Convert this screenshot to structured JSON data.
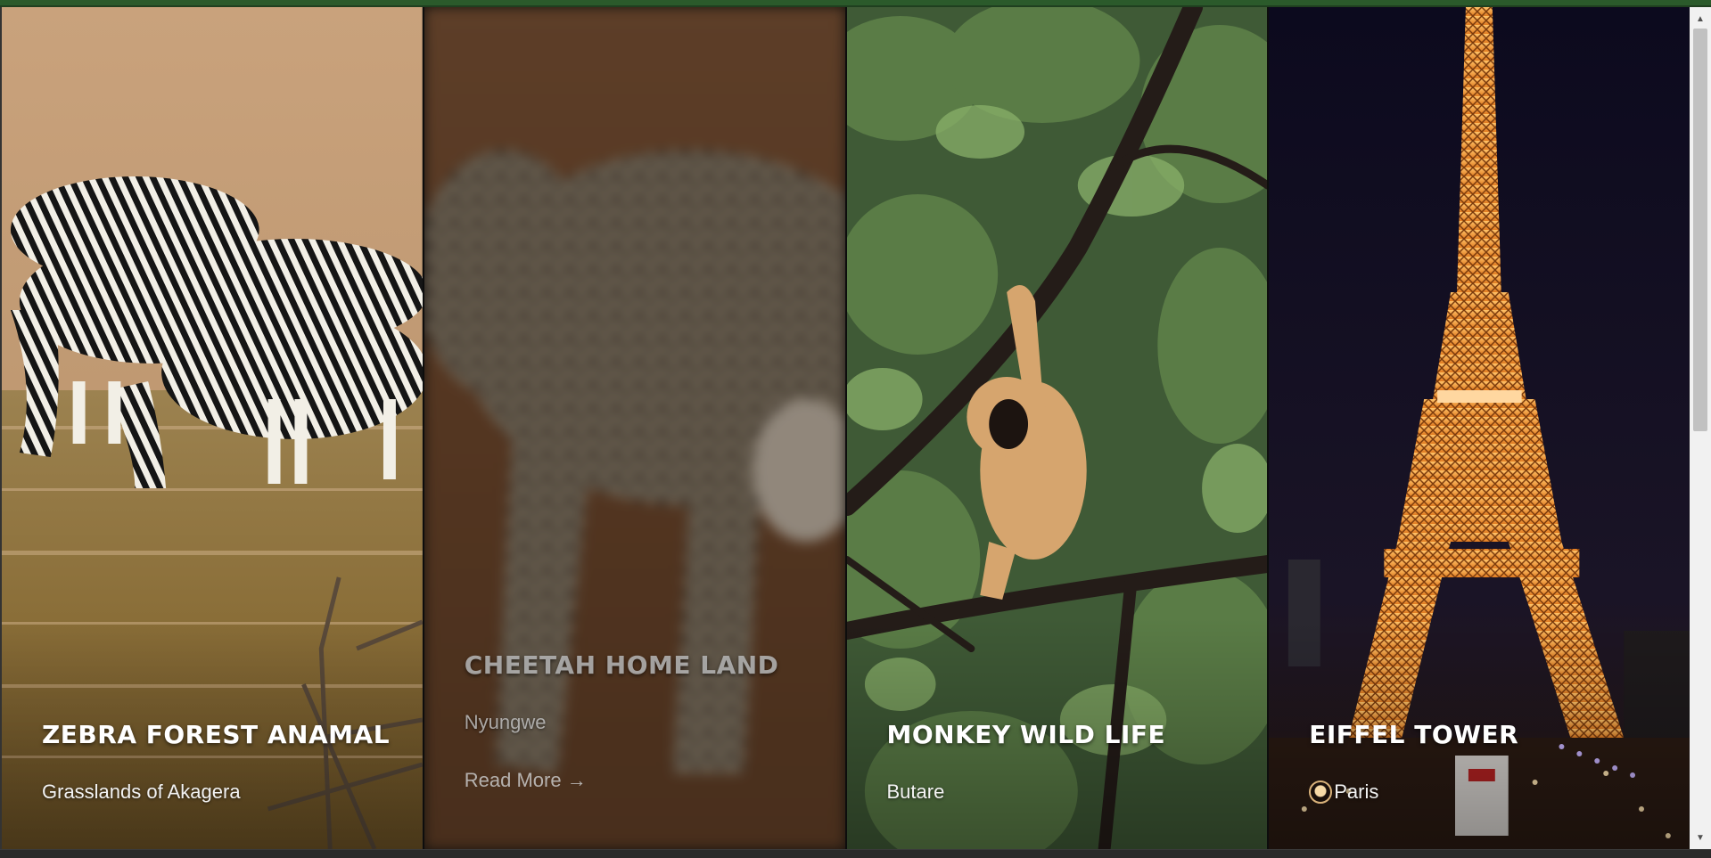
{
  "cards": [
    {
      "title": "ZEBRA FOREST ANAMAL",
      "location": "Grasslands of Akagera",
      "photo": "zebras-drinking-image"
    },
    {
      "title": "CHEETAH HOME LAND",
      "location": "Nyungwe",
      "read_more": "Read More →",
      "photo": "cheetah-image",
      "state": "hovered-blurred"
    },
    {
      "title": "MONKEY WILD LIFE",
      "location": "Butare",
      "photo": "gibbon-in-tree-image"
    },
    {
      "title": "EIFFEL TOWER",
      "location": "Paris",
      "photo": "eiffel-tower-night-image",
      "location_icon": "location-pin-icon"
    }
  ],
  "colors": {
    "top_accent": "#2b5a2b",
    "title_text": "#ffffff"
  },
  "scrollbar": {
    "up_icon": "scroll-up-arrow-icon",
    "down_icon": "scroll-down-arrow-icon"
  }
}
